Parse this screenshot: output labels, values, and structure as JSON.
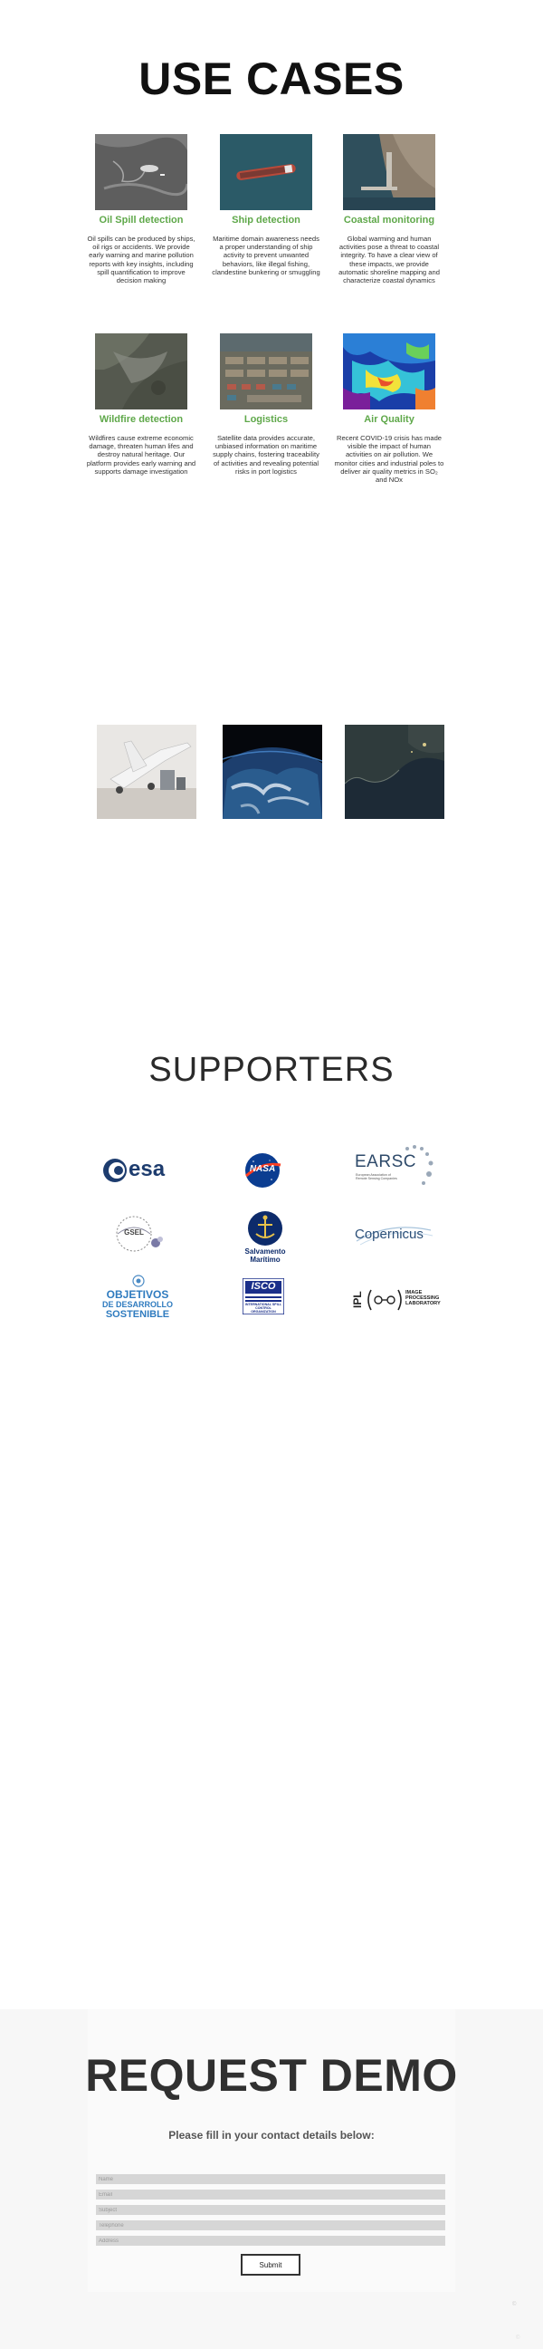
{
  "usecases": {
    "title": "USE CASES",
    "cards": [
      {
        "title": "Oil Spill detection",
        "desc": "Oil spills can be produced by ships, oil rigs or accidents. We provide early warning and marine pollution reports with key insights, including spill quantification to improve decision making"
      },
      {
        "title": "Ship detection",
        "desc": "Maritime domain awareness needs a proper understanding of ship activity to prevent unwanted behaviors, like illegal fishing, clandestine bunkering or smuggling"
      },
      {
        "title": "Coastal monitoring",
        "desc": "Global warming and human activities pose a threat to coastal integrity. To have a clear view of these impacts, we provide automatic shoreline mapping and characterize coastal dynamics"
      },
      {
        "title": "Wildfire  detection",
        "desc": "Wildfires cause extreme economic damage, threaten human lifes and destroy natural heritage. Our platform provides early warning and supports damage investigation"
      },
      {
        "title": "Logistics",
        "desc": "Satellite data provides accurate, unbiased information on maritime supply chains, fostering traceability of activities and revealing potential risks in port logistics"
      },
      {
        "title": "Air Quality",
        "desc": "Recent COVID-19 crisis has made visible the impact of human activities on air pollution. We monitor cities and industrial poles to deliver air quality metrics in SO₂ and NOx"
      }
    ],
    "accent_color": "#5fa84a"
  },
  "supporters": {
    "title": "SUPPORTERS",
    "logos": {
      "esa": "esa",
      "nasa": "NASA",
      "earsc_name": "EARSC",
      "earsc_sub": "European Association of Remote Sensing Companies",
      "gsel": "GSEL",
      "salvamento_1": "Salvamento",
      "salvamento_2": "Marítimo",
      "copernicus": "Copernicus",
      "ods_1": "OBJETIVOS",
      "ods_2": "DE DESARROLLO",
      "ods_3": "SOSTENIBLE",
      "isco_1": "ISCO",
      "isco_2": "INTERNATIONAL SPILL CONTROL ORGANIZATION",
      "ipl_1": "IPL",
      "ipl_2": "IMAGE PROCESSING LABORATORY"
    }
  },
  "demo": {
    "title": "REQUEST DEMO",
    "subtitle": "Please fill in your contact details below:",
    "fields": {
      "name": "Name",
      "email": "Email",
      "subject": "Subject",
      "telephone": "Telephone",
      "address": "Address"
    },
    "submit": "Submit",
    "corner_1": "©",
    "corner_2": "©"
  }
}
